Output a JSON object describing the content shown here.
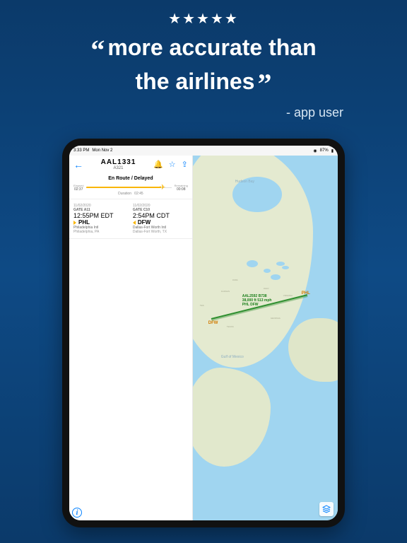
{
  "promo": {
    "stars": "★★★★★",
    "quote_line1": "more accurate than",
    "quote_line2": "the airlines",
    "attribution": "- app user"
  },
  "statusbar": {
    "time": "3:33 PM",
    "date": "Mon Nov 2",
    "battery": "87%"
  },
  "flight": {
    "callsign": "AAL1331",
    "aircraft": "A321",
    "status": "En Route / Delayed",
    "elapsed_label": "Elapsed",
    "elapsed": "02:37",
    "duration_label": "Duration",
    "duration": "02:45",
    "remaining_label": "Remaining",
    "remaining": "00:08"
  },
  "departure": {
    "date": "11/02/2020",
    "gate": "GATE A11",
    "time": "12:55PM EDT",
    "code": "PHL",
    "airport": "Philadelphia Intl",
    "city": "Philadelphia, PA"
  },
  "arrival": {
    "date": "11/02/2020",
    "gate": "GATE C10",
    "time": "2:54PM CDT",
    "code": "DFW",
    "airport": "Dallas-Fort Worth Intl",
    "city": "Dallas-Fort Worth, TX"
  },
  "map": {
    "hudson": "Hudson Bay",
    "gulf": "Gulf of Mexico",
    "dep_code": "PHL",
    "arr_code": "DFW",
    "flight_line1": "AAL2592 B738",
    "flight_line2": "38,000 ft 513 mph",
    "flight_line3": "PHL DFW"
  },
  "chart_data": {
    "type": "progress",
    "elapsed_hhmm": "02:37",
    "duration_hhmm": "02:45",
    "remaining_hhmm": "00:08",
    "progress_pct": 95
  },
  "colors": {
    "accent_blue": "#0a84ff",
    "progress_amber": "#f9b500",
    "route_green": "#2f8f2f"
  }
}
